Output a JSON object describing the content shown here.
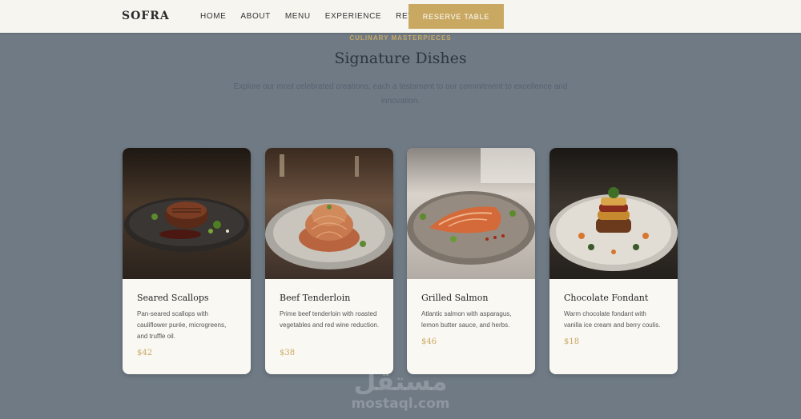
{
  "brand": {
    "logo": "SOFRA",
    "accent": "#c9a862"
  },
  "nav": {
    "items": [
      "HOME",
      "ABOUT",
      "MENU",
      "EXPERIENCE",
      "REVIEWS"
    ],
    "cta": "RESERVE TABLE"
  },
  "section": {
    "eyebrow": "CULINARY MASTERPIECES",
    "title": "Signature Dishes",
    "subtitle": "Explore our most celebrated creations, each a testament to our commitment to excellence and innovation."
  },
  "dishes": [
    {
      "name": "Seared Scallops",
      "description": "Pan-seared scallops with cauliflower purée, microgreens, and truffle oil.",
      "price": "$42",
      "image": "steak-plate-image"
    },
    {
      "name": "Beef Tenderloin",
      "description": "Prime beef tenderloin with roasted vegetables and red wine reduction.",
      "price": "$38",
      "image": "pasta-plate-image"
    },
    {
      "name": "Grilled Salmon",
      "description": "Atlantic salmon with asparagus, lemon butter sauce, and herbs.",
      "price": "$46",
      "image": "salmon-plate-image"
    },
    {
      "name": "Chocolate Fondant",
      "description": "Warm chocolate fondant with vanilla ice cream and berry coulis.",
      "price": "$18",
      "image": "stacked-dish-image"
    }
  ],
  "watermark": {
    "arabic": "مستقل",
    "latin": "mostaql.com"
  }
}
